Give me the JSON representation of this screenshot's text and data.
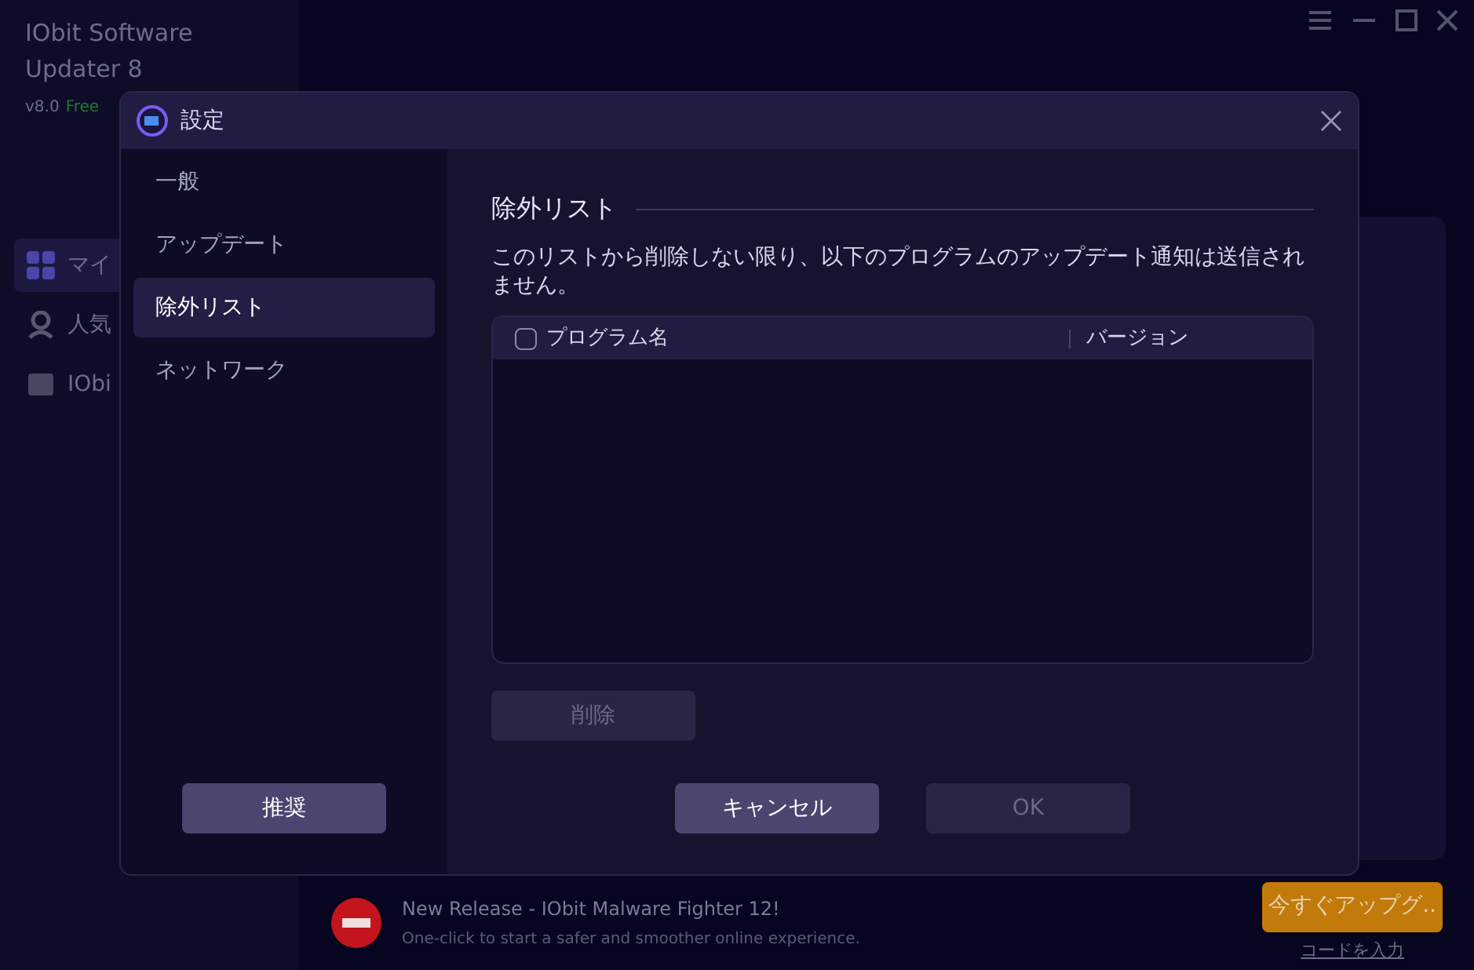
{
  "app": {
    "title": "IObit Software Updater 8",
    "version": "v8.0",
    "edition": "Free",
    "sidebar": [
      {
        "label": "マイ",
        "selected": true
      },
      {
        "label": "人気",
        "selected": false
      },
      {
        "label": "IObi",
        "selected": false
      }
    ]
  },
  "dialog": {
    "title": "設定",
    "nav": [
      {
        "label": "一般",
        "selected": false
      },
      {
        "label": "アップデート",
        "selected": false
      },
      {
        "label": "除外リスト",
        "selected": true
      },
      {
        "label": "ネットワーク",
        "selected": false
      }
    ],
    "recommend_button": "推奨",
    "section_title": "除外リスト",
    "description": "このリストから削除しない限り、以下のプログラムのアップデート通知は送信されません。",
    "table": {
      "select_all_checked": false,
      "columns": [
        "プログラム名",
        "バージョン"
      ]
    },
    "delete_button": {
      "label": "削除",
      "disabled": true
    },
    "cancel_button": {
      "label": "キャンセル",
      "disabled": false
    },
    "ok_button": {
      "label": "OK",
      "disabled": true
    }
  },
  "banner": {
    "title": "New Release - IObit Malware Fighter 12!",
    "subtitle": "One-click to start a safer and smoother online experience.",
    "upgrade_button": "今すぐアップグ..",
    "code_link": "コードを入力"
  }
}
